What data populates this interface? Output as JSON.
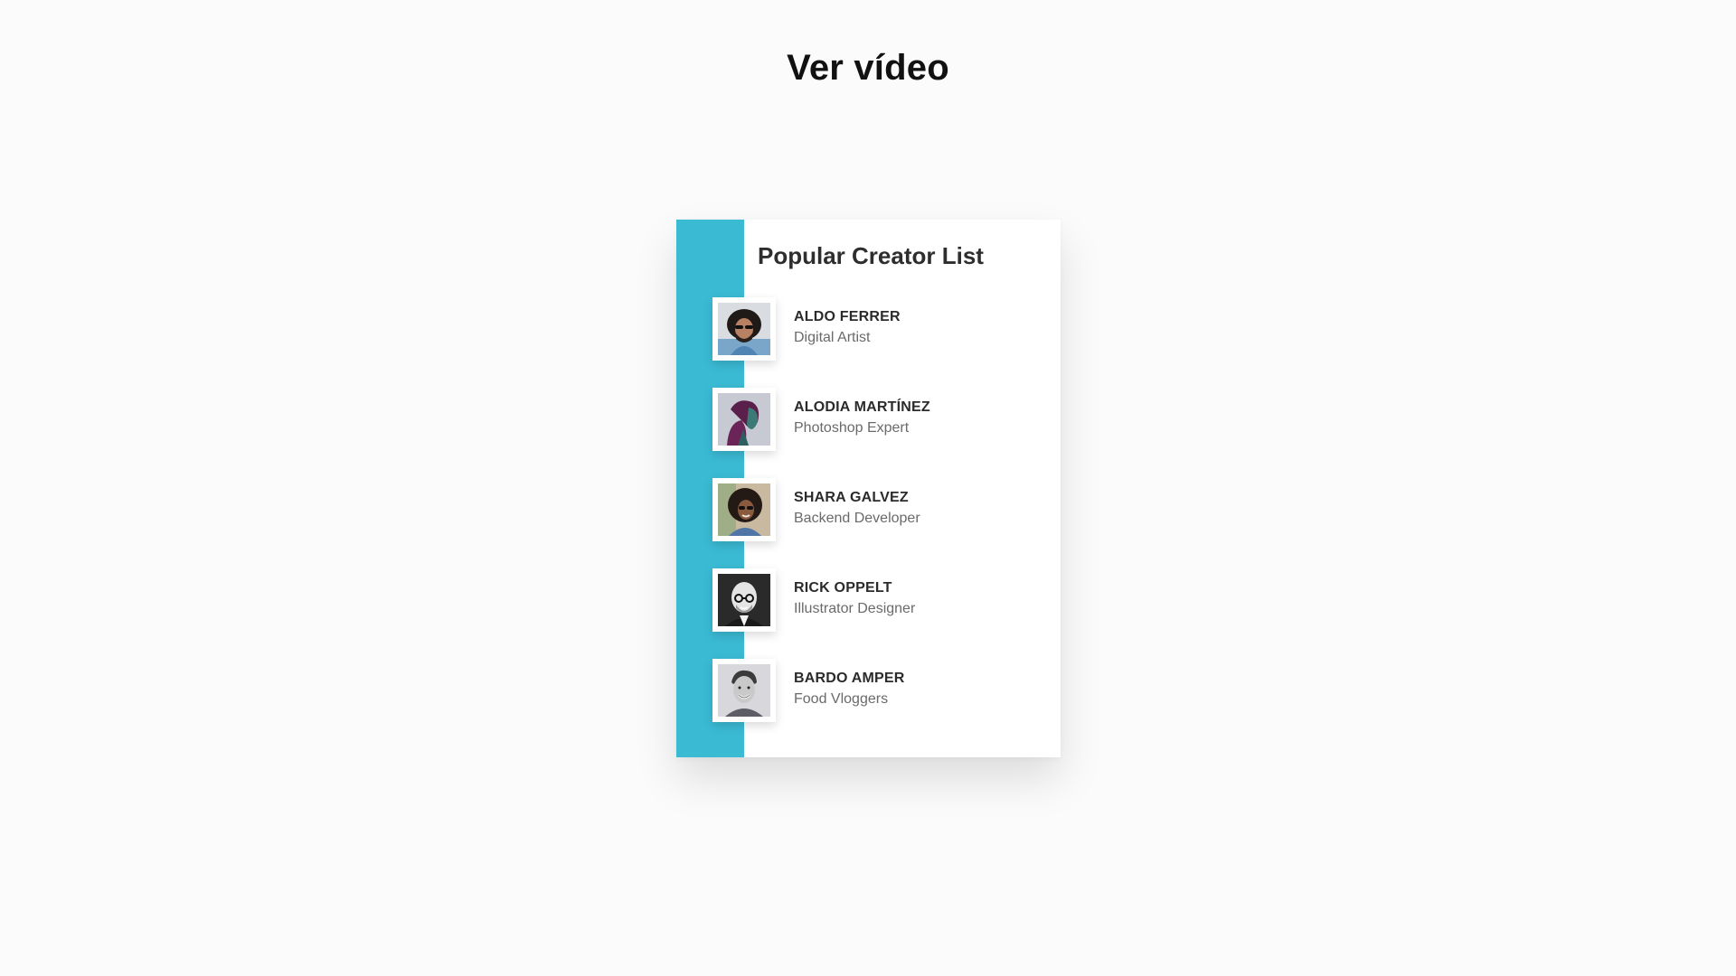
{
  "page": {
    "heading": "Ver vídeo"
  },
  "card": {
    "title": "Popular Creator List",
    "accent_color": "#3bbad4",
    "creators": [
      {
        "name": "ALDO FERRER",
        "role": "Digital Artist",
        "avatar_icon": "avatar-man-curly-hair-sunglasses"
      },
      {
        "name": "ALODIA MARTÍNEZ",
        "role": "Photoshop Expert",
        "avatar_icon": "avatar-woman-profile-purple"
      },
      {
        "name": "SHARA GALVEZ",
        "role": "Backend Developer",
        "avatar_icon": "avatar-woman-curly-hair-sunglasses"
      },
      {
        "name": "RICK OPPELT",
        "role": "Illustrator Designer",
        "avatar_icon": "avatar-bald-man-glasses"
      },
      {
        "name": "BARDO AMPER",
        "role": "Food Vloggers",
        "avatar_icon": "avatar-man-smiling"
      }
    ]
  }
}
